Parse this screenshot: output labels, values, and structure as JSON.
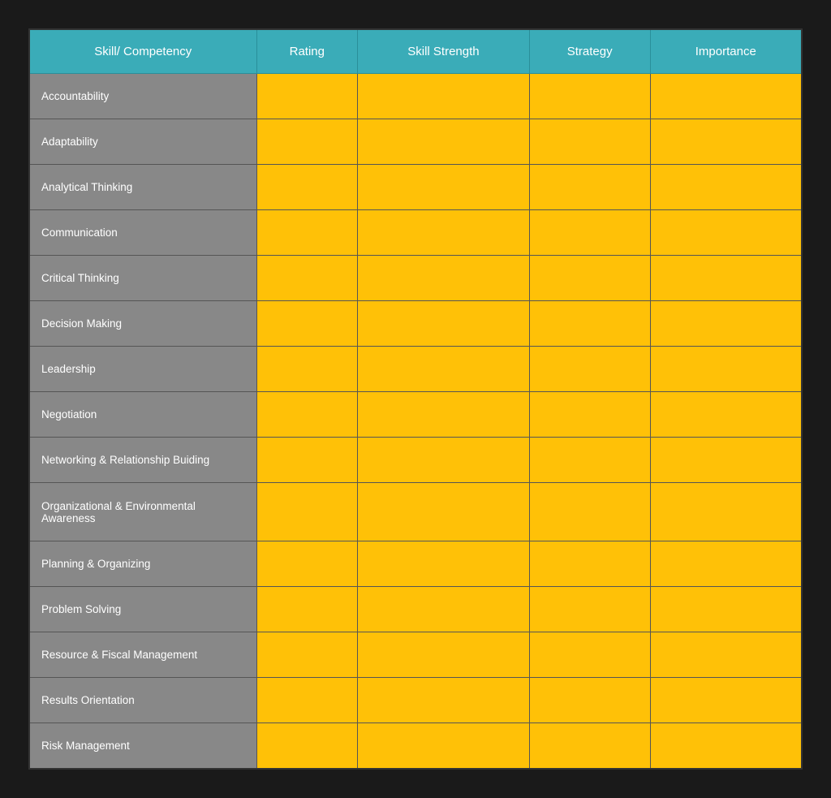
{
  "header": {
    "col1": "Skill/ Competency",
    "col2": "Rating",
    "col3": "Skill Strength",
    "col4": "Strategy",
    "col5": "Importance"
  },
  "rows": [
    {
      "label": "Accountability",
      "tall": false
    },
    {
      "label": "Adaptability",
      "tall": false
    },
    {
      "label": "Analytical Thinking",
      "tall": false
    },
    {
      "label": "Communication",
      "tall": false
    },
    {
      "label": "Critical Thinking",
      "tall": false
    },
    {
      "label": "Decision Making",
      "tall": false
    },
    {
      "label": "Leadership",
      "tall": false
    },
    {
      "label": "Negotiation",
      "tall": false
    },
    {
      "label": "Networking & Relationship Buiding",
      "tall": false
    },
    {
      "label": "Organizational & Environmental Awareness",
      "tall": true
    },
    {
      "label": "Planning & Organizing",
      "tall": false
    },
    {
      "label": "Problem Solving",
      "tall": false
    },
    {
      "label": "Resource & Fiscal Management",
      "tall": false
    },
    {
      "label": "Results Orientation",
      "tall": false
    },
    {
      "label": "Risk Management",
      "tall": false
    }
  ]
}
